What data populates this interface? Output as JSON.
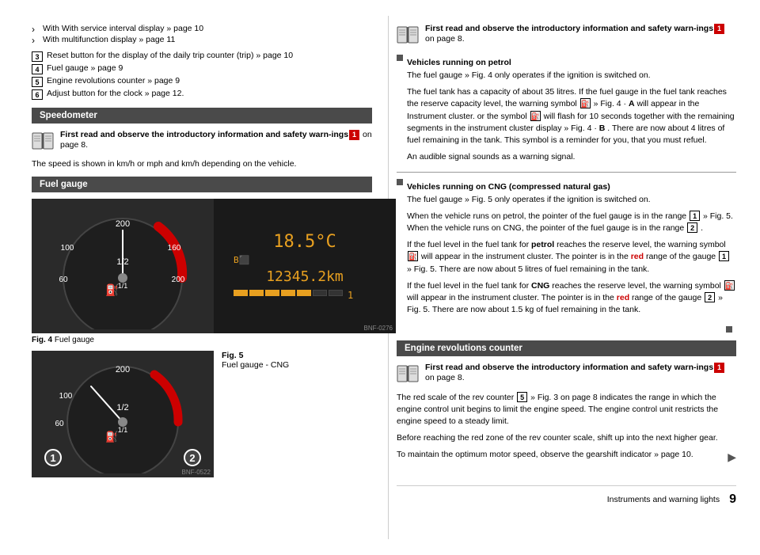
{
  "page": {
    "chapter": "Instruments and warning lights",
    "page_number": "9"
  },
  "left": {
    "bullets": [
      "With service interval display » page 10",
      "With multifunction display » page 11"
    ],
    "numbered_items": [
      {
        "num": "3",
        "text": "Reset button for the display of the daily trip counter (trip) » page 10"
      },
      {
        "num": "4",
        "text": "Fuel gauge » page 9"
      },
      {
        "num": "5",
        "text": "Engine revolutions counter » page 9"
      },
      {
        "num": "6",
        "text": "Adjust button for the clock » page 12."
      }
    ],
    "speedometer": {
      "header": "Speedometer",
      "warning": {
        "bold_text": "First read and observe the introductory information and safety warn-ings",
        "num": "1",
        "suffix": " on page 8."
      },
      "body": "The speed is shown in km/h or mph and km/h depending on the vehicle."
    },
    "fuel_gauge": {
      "header": "Fuel gauge",
      "fig4_label": "Fig. 4",
      "fig4_text": "Fuel gauge",
      "fig5_label": "Fig. 5",
      "fig5_text": "Fuel gauge - CNG",
      "bnf_276": "BNF-0276",
      "bnf_522": "BNF-0522",
      "temp_value": "18.5",
      "odo_value": "12345.2",
      "temp_unit": "°C",
      "odo_unit": "km"
    }
  },
  "right": {
    "top_warning": {
      "bold_text": "First read and observe the introductory information and safety warn-ings",
      "num": "1",
      "suffix": " on page 8."
    },
    "petrol_section": {
      "header": "Vehicles running on petrol",
      "para1": "The fuel gauge » Fig. 4 only operates if the ignition is switched on.",
      "para2": "The fuel tank has a capacity of about 35 litres. If the fuel gauge in the fuel tank reaches the reserve capacity level, the warning symbol",
      "para2b": "» Fig. 4 ·",
      "para2c": "A",
      "para2d": "will appear in the Instrument cluster. or the symbol",
      "para2e": "will flash for 10 seconds together with the remaining segments in the instrument cluster display » Fig. 4 ·",
      "para2f": "B",
      "para2g": ". There are now about 4 litres of fuel remaining in the tank. This symbol is a reminder for you, that you must refuel.",
      "para3": "An audible signal sounds as a warning signal."
    },
    "cng_section": {
      "header": "Vehicles running on CNG (compressed natural gas)",
      "para1": "The fuel gauge » Fig. 5 only operates if the ignition is switched on.",
      "para2": "When the vehicle runs on petrol, the pointer of the fuel gauge is in the range",
      "para2b": "1",
      "para2c": "» Fig. 5. When the vehicle runs on CNG, the pointer of the fuel gauge is in the range",
      "para2d": "2",
      "para2e": ".",
      "para3_start": "If the fuel level in the fuel tank for",
      "para3_bold": "petrol",
      "para3_end": "reaches the reserve level, the warning symbol",
      "para3b": "will appear in the instrument cluster. The pointer is in the",
      "para3_red": "red",
      "para3c": "range of the gauge",
      "para3d": "1",
      "para3e": "» Fig. 5. There are now about 5 litres of fuel remaining in the tank.",
      "para4_start": "If the fuel level in the fuel tank for",
      "para4_bold": "CNG",
      "para4_end": "reaches the reserve level, the warning symbol",
      "para4b": "will appear in the instrument cluster. The pointer is in the",
      "para4_red": "red",
      "para4c": "range of the gauge",
      "para4d": "2",
      "para4e": "» Fig. 5. There are now about 1.5 kg of fuel remaining in the tank."
    },
    "engine_rev": {
      "header": "Engine revolutions counter",
      "warning": {
        "bold_text": "First read and observe the introductory information and safety warn-ings",
        "num": "1",
        "suffix": " on page 8."
      },
      "para1": "The red scale of the rev counter",
      "para1_num": "5",
      "para1_end": "» Fig. 3 on page 8 indicates the range in which the engine control unit begins to limit the engine speed. The engine control unit restricts the engine speed to a steady limit.",
      "para2": "Before reaching the red zone of the rev counter scale, shift up into the next higher gear.",
      "para3": "To maintain the optimum motor speed, observe the gearshift indicator » page 10.",
      "arrow": "▶"
    }
  }
}
